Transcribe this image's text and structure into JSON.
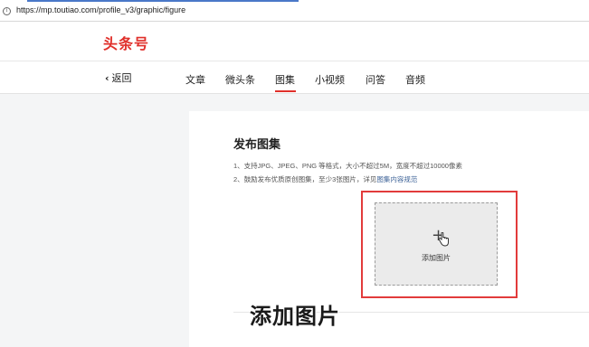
{
  "browser": {
    "url": "https://mp.toutiao.com/profile_v3/graphic/figure",
    "info_icon": "i"
  },
  "header": {
    "logo": "头条号"
  },
  "nav": {
    "back_label": "返回",
    "tabs": [
      {
        "label": "文章",
        "active": false
      },
      {
        "label": "微头条",
        "active": false
      },
      {
        "label": "图集",
        "active": true
      },
      {
        "label": "小视频",
        "active": false
      },
      {
        "label": "问答",
        "active": false
      },
      {
        "label": "音频",
        "active": false
      }
    ]
  },
  "panel": {
    "title": "发布图集",
    "note1": "1、支持JPG、JPEG、PNG 等格式，大小不超过5M，宽度不超过10000像素",
    "note2_prefix": "2、鼓励发布优质原创图集，至少3张图片，详见",
    "note2_link": "图集内容规范",
    "upload_label": "添加图片",
    "upload_plus": "+"
  },
  "caption": "添加图片",
  "colors": {
    "brand_red": "#e0302b",
    "highlight_red": "#e23b3b",
    "link_blue": "#406599"
  }
}
